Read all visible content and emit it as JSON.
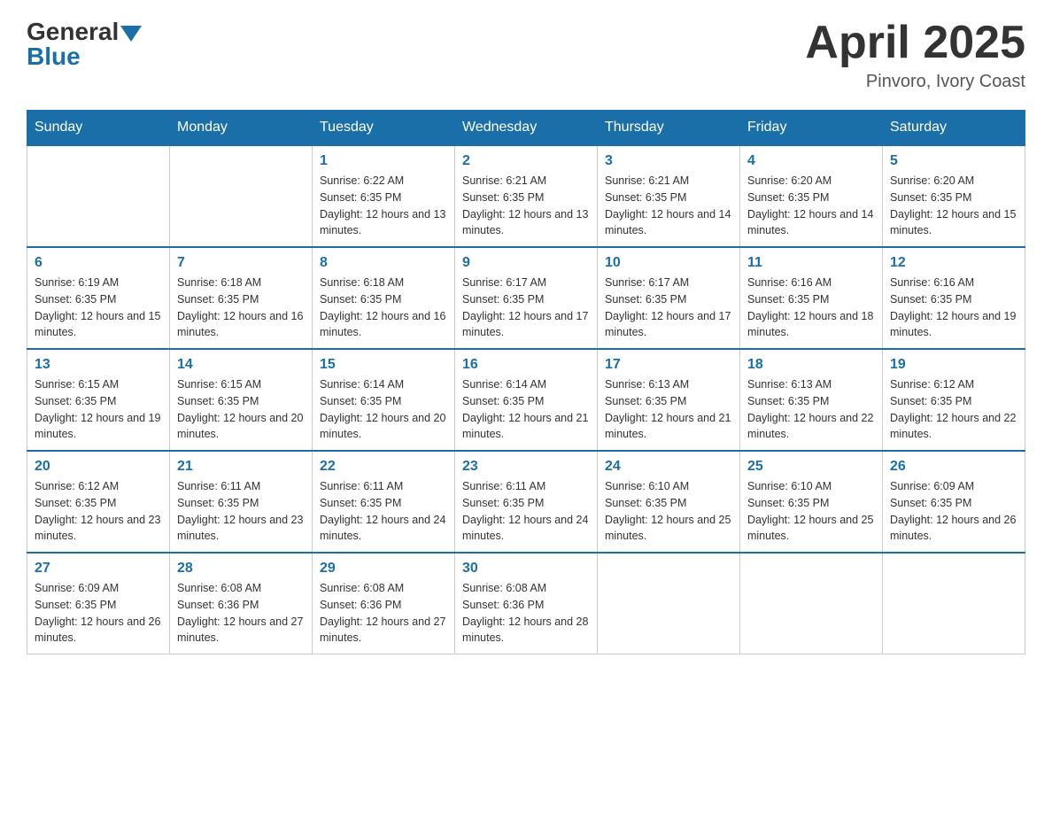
{
  "header": {
    "logo_general": "General",
    "logo_blue": "Blue",
    "month_title": "April 2025",
    "location": "Pinvoro, Ivory Coast"
  },
  "weekdays": [
    "Sunday",
    "Monday",
    "Tuesday",
    "Wednesday",
    "Thursday",
    "Friday",
    "Saturday"
  ],
  "weeks": [
    [
      {
        "day": "",
        "info": ""
      },
      {
        "day": "",
        "info": ""
      },
      {
        "day": "1",
        "info": "Sunrise: 6:22 AM\nSunset: 6:35 PM\nDaylight: 12 hours and 13 minutes."
      },
      {
        "day": "2",
        "info": "Sunrise: 6:21 AM\nSunset: 6:35 PM\nDaylight: 12 hours and 13 minutes."
      },
      {
        "day": "3",
        "info": "Sunrise: 6:21 AM\nSunset: 6:35 PM\nDaylight: 12 hours and 14 minutes."
      },
      {
        "day": "4",
        "info": "Sunrise: 6:20 AM\nSunset: 6:35 PM\nDaylight: 12 hours and 14 minutes."
      },
      {
        "day": "5",
        "info": "Sunrise: 6:20 AM\nSunset: 6:35 PM\nDaylight: 12 hours and 15 minutes."
      }
    ],
    [
      {
        "day": "6",
        "info": "Sunrise: 6:19 AM\nSunset: 6:35 PM\nDaylight: 12 hours and 15 minutes."
      },
      {
        "day": "7",
        "info": "Sunrise: 6:18 AM\nSunset: 6:35 PM\nDaylight: 12 hours and 16 minutes."
      },
      {
        "day": "8",
        "info": "Sunrise: 6:18 AM\nSunset: 6:35 PM\nDaylight: 12 hours and 16 minutes."
      },
      {
        "day": "9",
        "info": "Sunrise: 6:17 AM\nSunset: 6:35 PM\nDaylight: 12 hours and 17 minutes."
      },
      {
        "day": "10",
        "info": "Sunrise: 6:17 AM\nSunset: 6:35 PM\nDaylight: 12 hours and 17 minutes."
      },
      {
        "day": "11",
        "info": "Sunrise: 6:16 AM\nSunset: 6:35 PM\nDaylight: 12 hours and 18 minutes."
      },
      {
        "day": "12",
        "info": "Sunrise: 6:16 AM\nSunset: 6:35 PM\nDaylight: 12 hours and 19 minutes."
      }
    ],
    [
      {
        "day": "13",
        "info": "Sunrise: 6:15 AM\nSunset: 6:35 PM\nDaylight: 12 hours and 19 minutes."
      },
      {
        "day": "14",
        "info": "Sunrise: 6:15 AM\nSunset: 6:35 PM\nDaylight: 12 hours and 20 minutes."
      },
      {
        "day": "15",
        "info": "Sunrise: 6:14 AM\nSunset: 6:35 PM\nDaylight: 12 hours and 20 minutes."
      },
      {
        "day": "16",
        "info": "Sunrise: 6:14 AM\nSunset: 6:35 PM\nDaylight: 12 hours and 21 minutes."
      },
      {
        "day": "17",
        "info": "Sunrise: 6:13 AM\nSunset: 6:35 PM\nDaylight: 12 hours and 21 minutes."
      },
      {
        "day": "18",
        "info": "Sunrise: 6:13 AM\nSunset: 6:35 PM\nDaylight: 12 hours and 22 minutes."
      },
      {
        "day": "19",
        "info": "Sunrise: 6:12 AM\nSunset: 6:35 PM\nDaylight: 12 hours and 22 minutes."
      }
    ],
    [
      {
        "day": "20",
        "info": "Sunrise: 6:12 AM\nSunset: 6:35 PM\nDaylight: 12 hours and 23 minutes."
      },
      {
        "day": "21",
        "info": "Sunrise: 6:11 AM\nSunset: 6:35 PM\nDaylight: 12 hours and 23 minutes."
      },
      {
        "day": "22",
        "info": "Sunrise: 6:11 AM\nSunset: 6:35 PM\nDaylight: 12 hours and 24 minutes."
      },
      {
        "day": "23",
        "info": "Sunrise: 6:11 AM\nSunset: 6:35 PM\nDaylight: 12 hours and 24 minutes."
      },
      {
        "day": "24",
        "info": "Sunrise: 6:10 AM\nSunset: 6:35 PM\nDaylight: 12 hours and 25 minutes."
      },
      {
        "day": "25",
        "info": "Sunrise: 6:10 AM\nSunset: 6:35 PM\nDaylight: 12 hours and 25 minutes."
      },
      {
        "day": "26",
        "info": "Sunrise: 6:09 AM\nSunset: 6:35 PM\nDaylight: 12 hours and 26 minutes."
      }
    ],
    [
      {
        "day": "27",
        "info": "Sunrise: 6:09 AM\nSunset: 6:35 PM\nDaylight: 12 hours and 26 minutes."
      },
      {
        "day": "28",
        "info": "Sunrise: 6:08 AM\nSunset: 6:36 PM\nDaylight: 12 hours and 27 minutes."
      },
      {
        "day": "29",
        "info": "Sunrise: 6:08 AM\nSunset: 6:36 PM\nDaylight: 12 hours and 27 minutes."
      },
      {
        "day": "30",
        "info": "Sunrise: 6:08 AM\nSunset: 6:36 PM\nDaylight: 12 hours and 28 minutes."
      },
      {
        "day": "",
        "info": ""
      },
      {
        "day": "",
        "info": ""
      },
      {
        "day": "",
        "info": ""
      }
    ]
  ]
}
